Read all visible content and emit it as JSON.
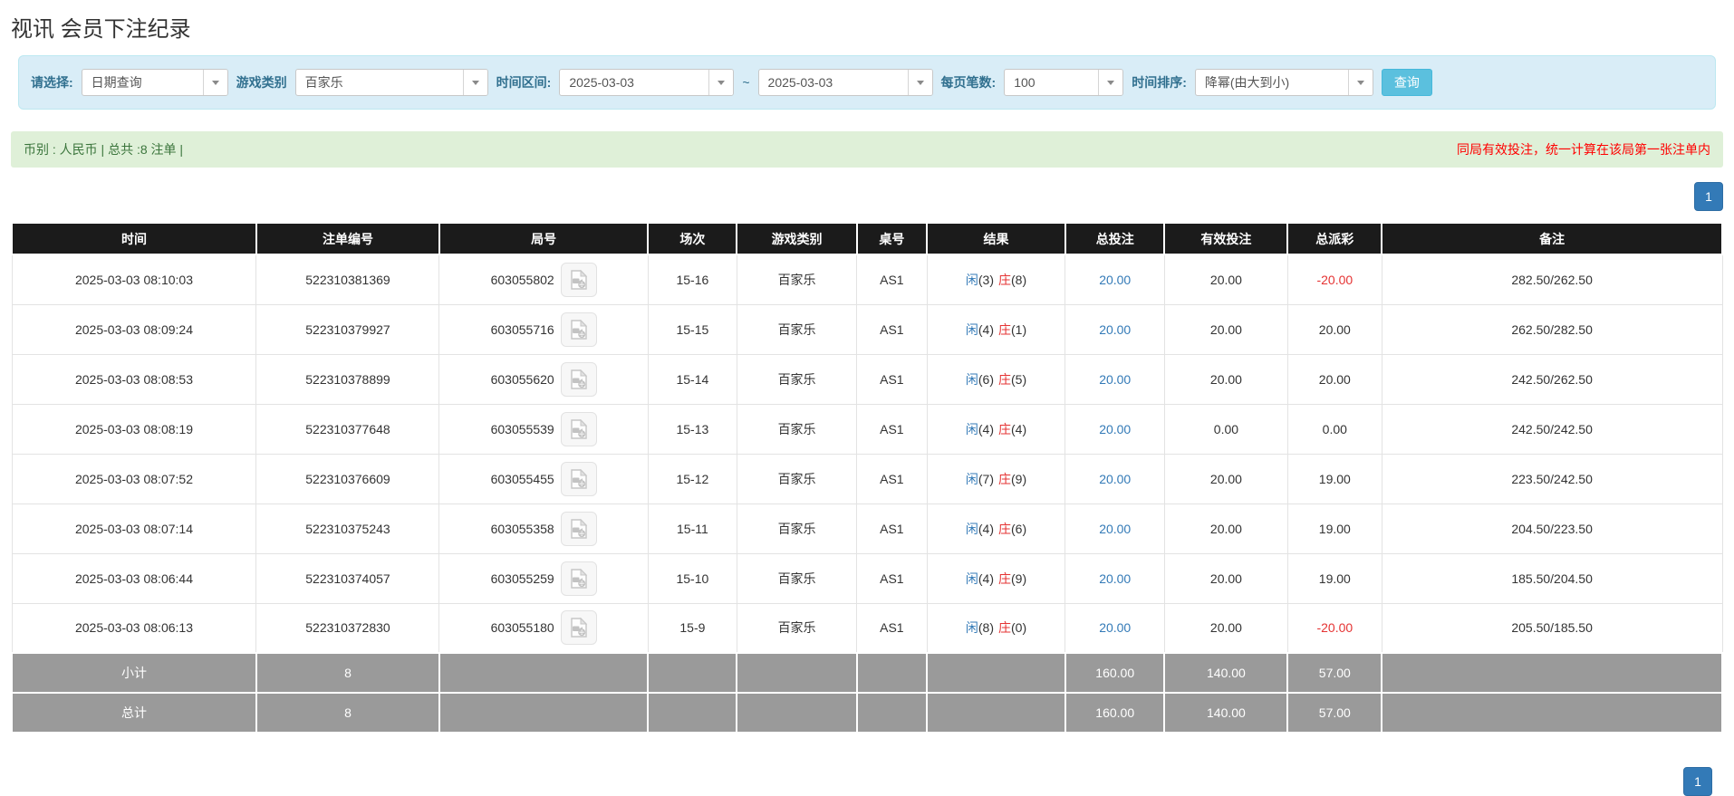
{
  "page": {
    "title": "视讯 会员下注纪录"
  },
  "filters": {
    "query_type_label": "请选择:",
    "query_type_value": "日期查询",
    "game_type_label": "游戏类别",
    "game_type_value": "百家乐",
    "time_range_label": "时间区间:",
    "date_from": "2025-03-03",
    "tilde": "~",
    "date_to": "2025-03-03",
    "per_page_label": "每页笔数:",
    "per_page_value": "100",
    "sort_label": "时间排序:",
    "sort_value": "降幂(由大到小)",
    "search_button": "查询"
  },
  "summary": {
    "left": "币别 : 人民币 | 总共 :8 注单 |",
    "right": "同局有效投注，统一计算在该局第一张注单内"
  },
  "pagination": {
    "page": "1"
  },
  "colors": {
    "header_bg": "#1b1b1b",
    "footer_bg": "#9a9a9a",
    "accent_blue": "#337ab7",
    "negative_red": "#e53333",
    "panel_blue": "#d9edf7",
    "alert_green": "#dff0d8",
    "search_btn": "#5bc0de"
  },
  "icons": {
    "chevron": "chevron-down-icon",
    "video": "video-file-icon"
  },
  "table": {
    "headers": [
      "时间",
      "注单编号",
      "局号",
      "场次",
      "游戏类别",
      "桌号",
      "结果",
      "总投注",
      "有效投注",
      "总派彩",
      "备注"
    ],
    "rows": [
      {
        "time": "2025-03-03 08:10:03",
        "bet_id": "522310381369",
        "round": "603055802",
        "session": "15-16",
        "game": "百家乐",
        "table_no": "AS1",
        "result_p_char": "闲",
        "result_p_num": "(3)",
        "result_b_char": "庄",
        "result_b_num": "(8)",
        "total_bet": "20.00",
        "valid_bet": "20.00",
        "payout": "-20.00",
        "remark": "282.50/262.50"
      },
      {
        "time": "2025-03-03 08:09:24",
        "bet_id": "522310379927",
        "round": "603055716",
        "session": "15-15",
        "game": "百家乐",
        "table_no": "AS1",
        "result_p_char": "闲",
        "result_p_num": "(4)",
        "result_b_char": "庄",
        "result_b_num": "(1)",
        "total_bet": "20.00",
        "valid_bet": "20.00",
        "payout": "20.00",
        "remark": "262.50/282.50"
      },
      {
        "time": "2025-03-03 08:08:53",
        "bet_id": "522310378899",
        "round": "603055620",
        "session": "15-14",
        "game": "百家乐",
        "table_no": "AS1",
        "result_p_char": "闲",
        "result_p_num": "(6)",
        "result_b_char": "庄",
        "result_b_num": "(5)",
        "total_bet": "20.00",
        "valid_bet": "20.00",
        "payout": "20.00",
        "remark": "242.50/262.50"
      },
      {
        "time": "2025-03-03 08:08:19",
        "bet_id": "522310377648",
        "round": "603055539",
        "session": "15-13",
        "game": "百家乐",
        "table_no": "AS1",
        "result_p_char": "闲",
        "result_p_num": "(4)",
        "result_b_char": "庄",
        "result_b_num": "(4)",
        "total_bet": "20.00",
        "valid_bet": "0.00",
        "payout": "0.00",
        "remark": "242.50/242.50"
      },
      {
        "time": "2025-03-03 08:07:52",
        "bet_id": "522310376609",
        "round": "603055455",
        "session": "15-12",
        "game": "百家乐",
        "table_no": "AS1",
        "result_p_char": "闲",
        "result_p_num": "(7)",
        "result_b_char": "庄",
        "result_b_num": "(9)",
        "total_bet": "20.00",
        "valid_bet": "20.00",
        "payout": "19.00",
        "remark": "223.50/242.50"
      },
      {
        "time": "2025-03-03 08:07:14",
        "bet_id": "522310375243",
        "round": "603055358",
        "session": "15-11",
        "game": "百家乐",
        "table_no": "AS1",
        "result_p_char": "闲",
        "result_p_num": "(4)",
        "result_b_char": "庄",
        "result_b_num": "(6)",
        "total_bet": "20.00",
        "valid_bet": "20.00",
        "payout": "19.00",
        "remark": "204.50/223.50"
      },
      {
        "time": "2025-03-03 08:06:44",
        "bet_id": "522310374057",
        "round": "603055259",
        "session": "15-10",
        "game": "百家乐",
        "table_no": "AS1",
        "result_p_char": "闲",
        "result_p_num": "(4)",
        "result_b_char": "庄",
        "result_b_num": "(9)",
        "total_bet": "20.00",
        "valid_bet": "20.00",
        "payout": "19.00",
        "remark": "185.50/204.50"
      },
      {
        "time": "2025-03-03 08:06:13",
        "bet_id": "522310372830",
        "round": "603055180",
        "session": "15-9",
        "game": "百家乐",
        "table_no": "AS1",
        "result_p_char": "闲",
        "result_p_num": "(8)",
        "result_b_char": "庄",
        "result_b_num": "(0)",
        "total_bet": "20.00",
        "valid_bet": "20.00",
        "payout": "-20.00",
        "remark": "205.50/185.50"
      }
    ],
    "footer": [
      {
        "label": "小计",
        "count": "8",
        "total_bet": "160.00",
        "valid_bet": "140.00",
        "payout": "57.00"
      },
      {
        "label": "总计",
        "count": "8",
        "total_bet": "160.00",
        "valid_bet": "140.00",
        "payout": "57.00"
      }
    ]
  }
}
